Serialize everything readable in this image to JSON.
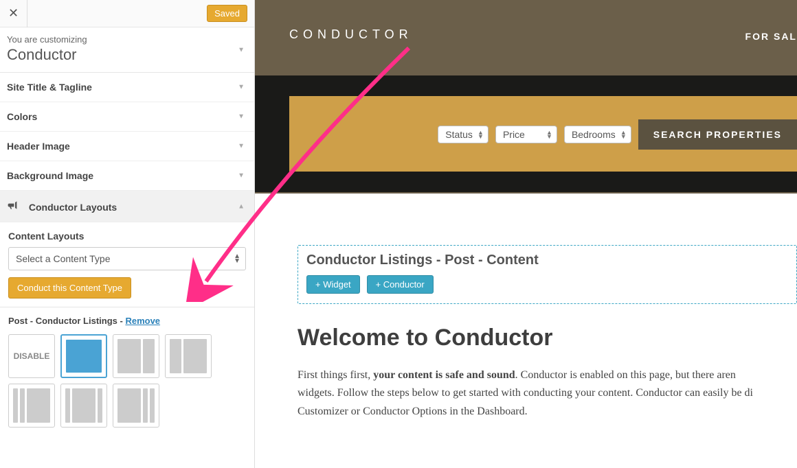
{
  "topbar": {
    "saved": "Saved"
  },
  "customizing": {
    "small": "You are customizing",
    "big": "Conductor"
  },
  "sections": {
    "site_title": "Site Title & Tagline",
    "colors": "Colors",
    "header_image": "Header Image",
    "background_image": "Background Image",
    "conductor_layouts": "Conductor Layouts"
  },
  "subpanel": {
    "heading": "Content Layouts",
    "select_placeholder": "Select a Content Type",
    "button": "Conduct this Content Type"
  },
  "listings": {
    "prefix": "Post - Conductor Listings",
    "dash": " - ",
    "remove": "Remove",
    "disable": "DISABLE"
  },
  "preview": {
    "brand": "CONDUCTOR",
    "nav_forsale": "FOR SAL",
    "filter_status": "Status",
    "filter_price": "Price",
    "filter_bedrooms": "Bedrooms",
    "search_btn": "SEARCH PROPERTIES",
    "widget_title": "Conductor Listings - Post - Content",
    "add_widget": "+ Widget",
    "add_conductor": "+ Conductor",
    "welcome": "Welcome to Conductor",
    "p1a": "First things first, ",
    "p1b": "your content is safe and sound",
    "p1c": ". Conductor is enabled on this page, but there aren",
    "p2": "widgets. Follow the steps below to get started with conducting your content. Conductor can easily be di",
    "p3": "Customizer or Conductor Options in the Dashboard."
  }
}
